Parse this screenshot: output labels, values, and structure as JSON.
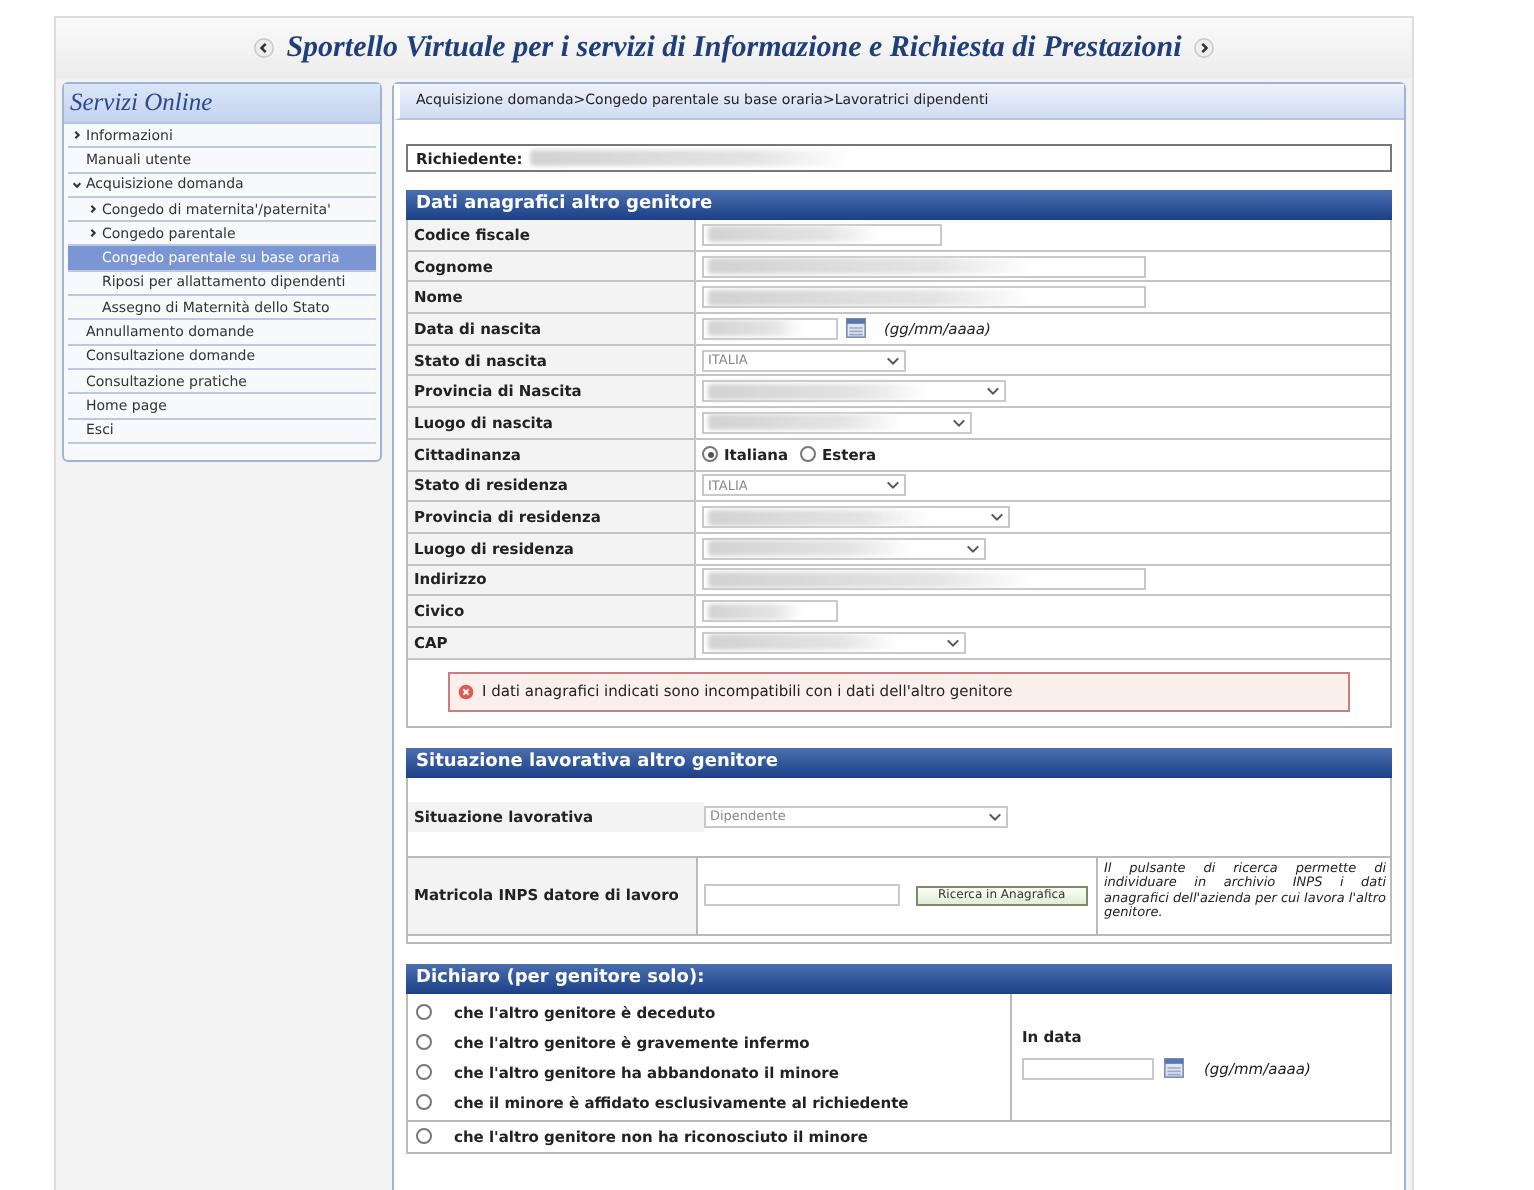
{
  "header": {
    "title": "Sportello Virtuale per i servizi di Informazione e Richiesta di Prestazioni"
  },
  "sidebar": {
    "title": "Servizi Online",
    "items": [
      {
        "label": "Informazioni",
        "expanded": false,
        "selected": false
      },
      {
        "label": "Manuali utente",
        "selected": false
      },
      {
        "label": "Acquisizione domanda",
        "expanded": true,
        "selected": false,
        "children": [
          {
            "label": "Congedo di maternita'/paternita'",
            "expanded": false,
            "selected": false
          },
          {
            "label": "Congedo parentale",
            "expanded": false,
            "selected": false
          },
          {
            "label": "Congedo parentale su base oraria",
            "selected": true
          },
          {
            "label": "Riposi per allattamento dipendenti",
            "selected": false
          },
          {
            "label": "Assegno di Maternità dello Stato",
            "selected": false
          }
        ]
      },
      {
        "label": "Annullamento domande",
        "selected": false
      },
      {
        "label": "Consultazione domande",
        "selected": false
      },
      {
        "label": "Consultazione pratiche",
        "selected": false
      },
      {
        "label": "Home page",
        "selected": false
      },
      {
        "label": "Esci",
        "selected": false
      }
    ]
  },
  "breadcrumb": "Acquisizione domanda>Congedo parentale su base oraria>Lavoratrici dipendenti",
  "requester": {
    "label": "Richiedente:"
  },
  "personal": {
    "title": "Dati anagrafici altro genitore",
    "rows": [
      {
        "label": "Codice fiscale",
        "kind": "text"
      },
      {
        "label": "Cognome",
        "kind": "text"
      },
      {
        "label": "Nome",
        "kind": "text"
      },
      {
        "label": "Data di nascita",
        "kind": "date",
        "hint": "(gg/mm/aaaa)"
      },
      {
        "label": "Stato di nascita",
        "kind": "select",
        "value": "ITALIA"
      },
      {
        "label": "Provincia di Nascita",
        "kind": "select"
      },
      {
        "label": "Luogo di nascita",
        "kind": "select"
      },
      {
        "label": "Cittadinanza",
        "kind": "radio",
        "options": [
          {
            "label": "Italiana",
            "selected": true
          },
          {
            "label": "Estera",
            "selected": false
          }
        ]
      },
      {
        "label": "Stato di residenza",
        "kind": "select",
        "value": "ITALIA"
      },
      {
        "label": "Provincia di residenza",
        "kind": "select"
      },
      {
        "label": "Luogo di residenza",
        "kind": "select"
      },
      {
        "label": "Indirizzo",
        "kind": "text"
      },
      {
        "label": "Civico",
        "kind": "text"
      },
      {
        "label": "CAP",
        "kind": "select"
      }
    ],
    "error": "I dati anagrafici indicati sono incompatibili con i dati dell'altro genitore"
  },
  "work": {
    "title": "Situazione lavorativa altro genitore",
    "situation_label": "Situazione lavorativa",
    "situation_value": "Dipendente",
    "situation_disabled": true,
    "matricola_label": "Matricola INPS datore di lavoro",
    "search_button": "Ricerca in Anagrafica",
    "note": "Il pulsante di ricerca permette di individuare in archivio INPS i dati anagrafici dell'azienda per cui lavora l'altro genitore."
  },
  "declaration": {
    "title": "Dichiaro (per genitore solo):",
    "options": [
      {
        "label": "che l'altro genitore è deceduto",
        "selected": false
      },
      {
        "label": "che l'altro genitore è gravemente infermo",
        "selected": false
      },
      {
        "label": "che l'altro genitore ha abbandonato il minore",
        "selected": false
      },
      {
        "label": "che il minore è affidato esclusivamente al richiedente",
        "selected": false
      }
    ],
    "date_label": "In data",
    "date_hint": "(gg/mm/aaaa)",
    "last_option": {
      "label": "che l'altro genitore non ha riconosciuto il minore",
      "selected": false
    }
  }
}
